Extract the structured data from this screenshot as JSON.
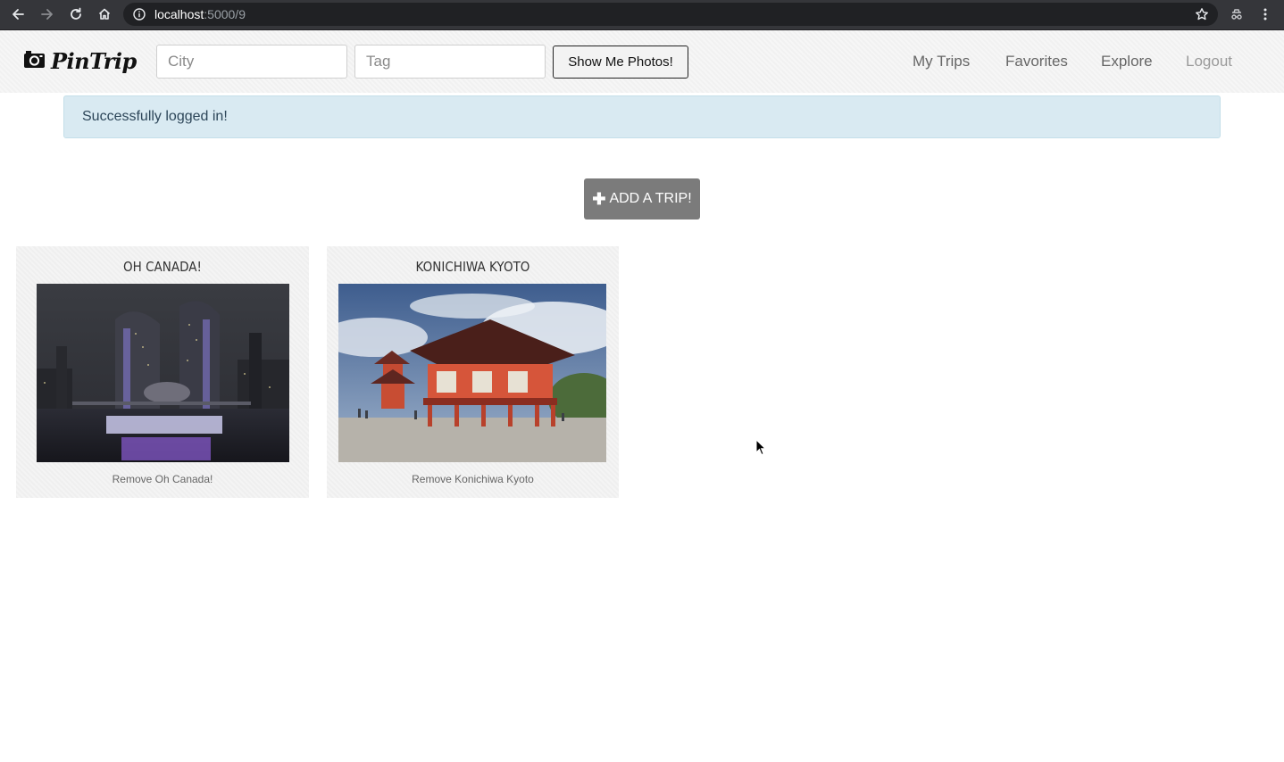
{
  "browser": {
    "url_host": "localhost",
    "url_path": ":5000/9",
    "icons": [
      "back-arrow-icon",
      "forward-arrow-icon",
      "reload-icon",
      "home-icon",
      "info-icon",
      "bookmark-star-icon",
      "incognito-icon",
      "kebab-menu-icon"
    ]
  },
  "nav": {
    "brand": "PinTrip",
    "brand_icon": "camera-icon",
    "city_placeholder": "City",
    "tag_placeholder": "Tag",
    "submit_label": "Show Me Photos!",
    "links": [
      "My Trips",
      "Favorites",
      "Explore",
      "Logout"
    ]
  },
  "alert": {
    "message": "Successfully logged in!"
  },
  "add_trip": {
    "label": "ADD A TRIP!",
    "icon": "plus-icon"
  },
  "trips": [
    {
      "title": "Oh Canada!",
      "remove_label": "Remove Oh Canada!"
    },
    {
      "title": "Konichiwa Kyoto",
      "remove_label": "Remove Konichiwa Kyoto"
    }
  ],
  "colors": {
    "chrome_bg": "#35363a",
    "navbar_bg": "#f6f6f6",
    "alert_bg": "#d9eaf2",
    "alert_text": "#2d4659",
    "add_trip_bg": "#7b7b7b"
  }
}
